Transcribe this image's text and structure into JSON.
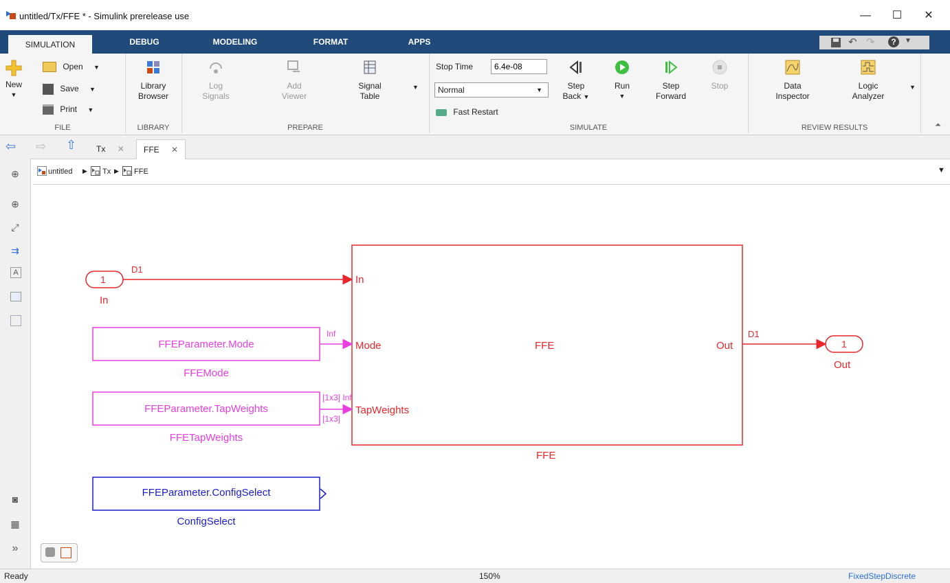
{
  "window": {
    "title": "untitled/Tx/FFE * - Simulink prerelease use",
    "min": "—",
    "max": "☐",
    "close": "✕"
  },
  "tabs": [
    "SIMULATION",
    "DEBUG",
    "MODELING",
    "FORMAT",
    "APPS"
  ],
  "ribbon": {
    "file": {
      "new": "New",
      "open": "Open",
      "save": "Save",
      "print": "Print",
      "group": "FILE"
    },
    "library": {
      "browser_l1": "Library",
      "browser_l2": "Browser",
      "group": "LIBRARY"
    },
    "prepare": {
      "log_l1": "Log",
      "log_l2": "Signals",
      "add_l1": "Add",
      "add_l2": "Viewer",
      "sigtable_l1": "Signal",
      "sigtable_l2": "Table",
      "group": "PREPARE"
    },
    "simulate": {
      "stop_time_label": "Stop Time",
      "stop_time_value": "6.4e-08",
      "mode": "Normal",
      "fast_restart": "Fast Restart",
      "step_back_l1": "Step",
      "step_back_l2": "Back",
      "run": "Run",
      "step_fwd_l1": "Step",
      "step_fwd_l2": "Forward",
      "stop": "Stop",
      "group": "SIMULATE"
    },
    "review": {
      "di_l1": "Data",
      "di_l2": "Inspector",
      "la_l1": "Logic",
      "la_l2": "Analyzer",
      "group": "REVIEW RESULTS"
    }
  },
  "doc_tabs": [
    "Tx",
    "FFE"
  ],
  "breadcrumb": [
    "untitled",
    "Tx",
    "FFE"
  ],
  "diagram": {
    "inport": {
      "num": "1",
      "name": "In"
    },
    "sig_d1_in": "D1",
    "ffe_block": {
      "title": "FFE",
      "name": "FFE",
      "port_in": "In",
      "port_mode": "Mode",
      "port_tap": "TapWeights",
      "port_out": "Out"
    },
    "mode_const": {
      "value": "FFEParameter.Mode",
      "name": "FFEMode",
      "sig": "Inf"
    },
    "tap_const": {
      "value": "FFEParameter.TapWeights",
      "name": "FFETapWeights",
      "sig1": "[1x3] Inf",
      "sig2": "[1x3]"
    },
    "config": {
      "value": "FFEParameter.ConfigSelect",
      "name": "ConfigSelect"
    },
    "sig_d1_out": "D1",
    "outport": {
      "num": "1",
      "name": "Out"
    }
  },
  "status": {
    "left": "Ready",
    "zoom": "150%",
    "solver": "FixedStepDiscrete"
  },
  "colors": {
    "accent": "#1f4a7a",
    "red": "#e8262b",
    "magenta": "#e83ee0",
    "blue": "#1a1acd"
  }
}
